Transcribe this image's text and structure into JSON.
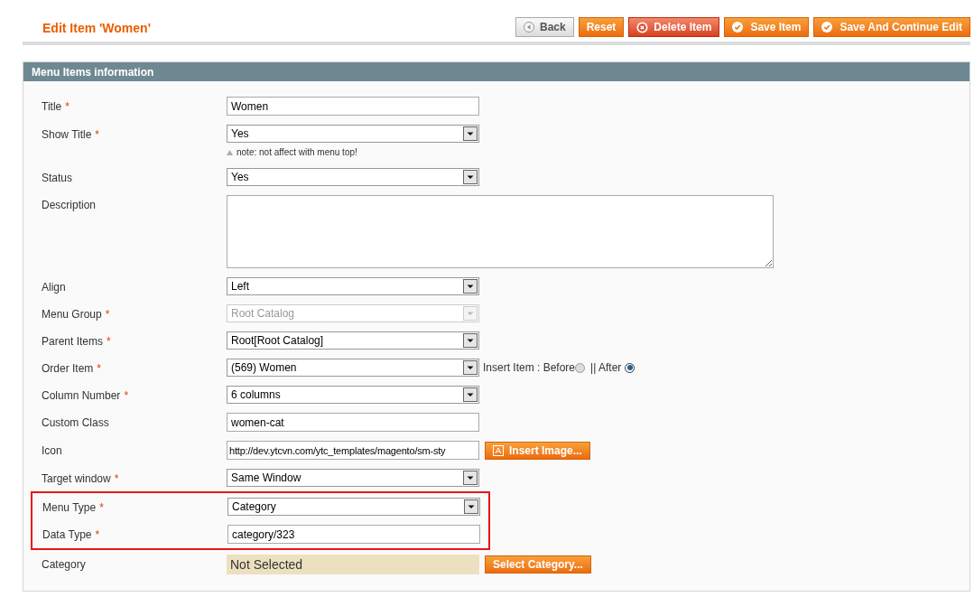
{
  "page_title": "Edit Item 'Women'",
  "buttons": [
    {
      "label": "Back",
      "kind": "back"
    },
    {
      "label": "Reset",
      "kind": "plain"
    },
    {
      "label": "Delete Item",
      "kind": "delete"
    },
    {
      "label": "Save Item",
      "kind": "save"
    },
    {
      "label": "Save And Continue Edit",
      "kind": "save"
    }
  ],
  "section": {
    "title": "Menu Items information",
    "rows": [
      {
        "label": "Title",
        "required_mark": "*",
        "kind": "text",
        "value": "Women",
        "highlighted": false
      },
      {
        "label": "Show Title",
        "required_mark": "*",
        "kind": "select",
        "value": "Yes",
        "disabled": false,
        "note": "note: not affect with menu top!",
        "highlighted": false
      },
      {
        "label": "Status",
        "kind": "select",
        "value": "Yes",
        "disabled": false,
        "highlighted": false
      },
      {
        "label": "Description",
        "kind": "textarea",
        "value": "",
        "highlighted": false
      },
      {
        "label": "Align",
        "kind": "select",
        "value": "Left",
        "disabled": false,
        "highlighted": false
      },
      {
        "label": "Menu Group",
        "required_mark": "*",
        "kind": "select",
        "value": "Root Catalog",
        "disabled": true,
        "highlighted": false
      },
      {
        "label": "Parent Items",
        "required_mark": "*",
        "kind": "select",
        "value": "Root[Root Catalog]",
        "disabled": false,
        "highlighted": false
      },
      {
        "label": "Order Item",
        "required_mark": "*",
        "kind": "select",
        "value": "(569) Women",
        "disabled": false,
        "highlighted": false,
        "radios": [
          {
            "label": "Insert Item : Before",
            "selected": false
          },
          {
            "label": "|| After",
            "selected": true
          }
        ]
      },
      {
        "label": "Column Number",
        "required_mark": "*",
        "kind": "select",
        "value": "6 columns",
        "disabled": false,
        "highlighted": false
      },
      {
        "label": "Custom Class",
        "kind": "text",
        "value": "women-cat",
        "highlighted": false
      },
      {
        "label": "Icon",
        "kind": "text",
        "value": "http://dev.ytcvn.com/ytc_templates/magento/sm-sty",
        "highlighted": false,
        "button": "Insert Image..."
      },
      {
        "label": "Target window",
        "required_mark": "*",
        "kind": "select",
        "value": "Same Window",
        "disabled": false,
        "highlighted": false
      },
      {
        "label": "Menu Type",
        "required_mark": "*",
        "kind": "select",
        "value": "Category",
        "disabled": false,
        "highlighted": true
      },
      {
        "label": "Data Type",
        "required_mark": "*",
        "kind": "text",
        "value": "category/323",
        "highlighted": true
      },
      {
        "label": "Category",
        "kind": "chooser",
        "value": "Not Selected",
        "highlighted": false,
        "button": "Select Category..."
      }
    ]
  }
}
